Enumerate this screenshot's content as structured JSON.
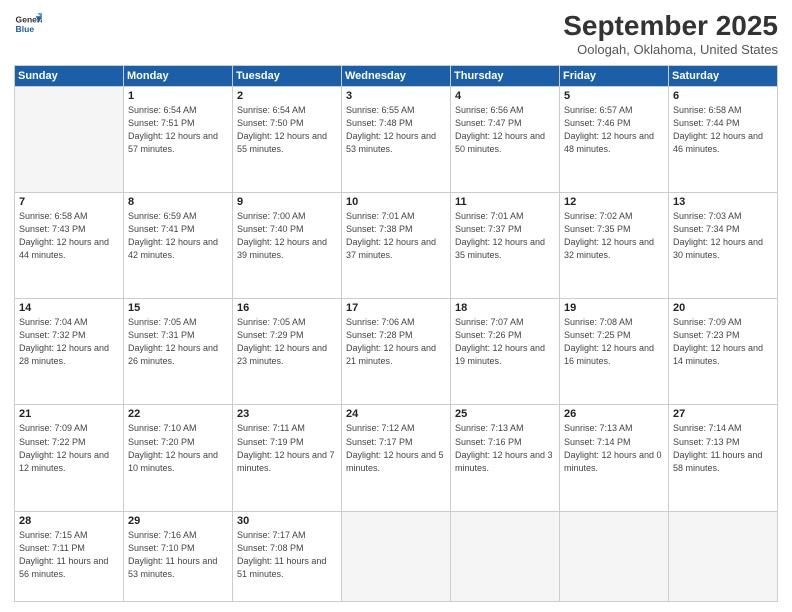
{
  "header": {
    "logo_line1": "General",
    "logo_line2": "Blue",
    "month_title": "September 2025",
    "location": "Oologah, Oklahoma, United States"
  },
  "weekdays": [
    "Sunday",
    "Monday",
    "Tuesday",
    "Wednesday",
    "Thursday",
    "Friday",
    "Saturday"
  ],
  "weeks": [
    [
      {
        "day": "",
        "empty": true
      },
      {
        "day": "1",
        "sunrise": "6:54 AM",
        "sunset": "7:51 PM",
        "daylight": "12 hours and 57 minutes."
      },
      {
        "day": "2",
        "sunrise": "6:54 AM",
        "sunset": "7:50 PM",
        "daylight": "12 hours and 55 minutes."
      },
      {
        "day": "3",
        "sunrise": "6:55 AM",
        "sunset": "7:48 PM",
        "daylight": "12 hours and 53 minutes."
      },
      {
        "day": "4",
        "sunrise": "6:56 AM",
        "sunset": "7:47 PM",
        "daylight": "12 hours and 50 minutes."
      },
      {
        "day": "5",
        "sunrise": "6:57 AM",
        "sunset": "7:46 PM",
        "daylight": "12 hours and 48 minutes."
      },
      {
        "day": "6",
        "sunrise": "6:58 AM",
        "sunset": "7:44 PM",
        "daylight": "12 hours and 46 minutes."
      }
    ],
    [
      {
        "day": "7",
        "sunrise": "6:58 AM",
        "sunset": "7:43 PM",
        "daylight": "12 hours and 44 minutes."
      },
      {
        "day": "8",
        "sunrise": "6:59 AM",
        "sunset": "7:41 PM",
        "daylight": "12 hours and 42 minutes."
      },
      {
        "day": "9",
        "sunrise": "7:00 AM",
        "sunset": "7:40 PM",
        "daylight": "12 hours and 39 minutes."
      },
      {
        "day": "10",
        "sunrise": "7:01 AM",
        "sunset": "7:38 PM",
        "daylight": "12 hours and 37 minutes."
      },
      {
        "day": "11",
        "sunrise": "7:01 AM",
        "sunset": "7:37 PM",
        "daylight": "12 hours and 35 minutes."
      },
      {
        "day": "12",
        "sunrise": "7:02 AM",
        "sunset": "7:35 PM",
        "daylight": "12 hours and 32 minutes."
      },
      {
        "day": "13",
        "sunrise": "7:03 AM",
        "sunset": "7:34 PM",
        "daylight": "12 hours and 30 minutes."
      }
    ],
    [
      {
        "day": "14",
        "sunrise": "7:04 AM",
        "sunset": "7:32 PM",
        "daylight": "12 hours and 28 minutes."
      },
      {
        "day": "15",
        "sunrise": "7:05 AM",
        "sunset": "7:31 PM",
        "daylight": "12 hours and 26 minutes."
      },
      {
        "day": "16",
        "sunrise": "7:05 AM",
        "sunset": "7:29 PM",
        "daylight": "12 hours and 23 minutes."
      },
      {
        "day": "17",
        "sunrise": "7:06 AM",
        "sunset": "7:28 PM",
        "daylight": "12 hours and 21 minutes."
      },
      {
        "day": "18",
        "sunrise": "7:07 AM",
        "sunset": "7:26 PM",
        "daylight": "12 hours and 19 minutes."
      },
      {
        "day": "19",
        "sunrise": "7:08 AM",
        "sunset": "7:25 PM",
        "daylight": "12 hours and 16 minutes."
      },
      {
        "day": "20",
        "sunrise": "7:09 AM",
        "sunset": "7:23 PM",
        "daylight": "12 hours and 14 minutes."
      }
    ],
    [
      {
        "day": "21",
        "sunrise": "7:09 AM",
        "sunset": "7:22 PM",
        "daylight": "12 hours and 12 minutes."
      },
      {
        "day": "22",
        "sunrise": "7:10 AM",
        "sunset": "7:20 PM",
        "daylight": "12 hours and 10 minutes."
      },
      {
        "day": "23",
        "sunrise": "7:11 AM",
        "sunset": "7:19 PM",
        "daylight": "12 hours and 7 minutes."
      },
      {
        "day": "24",
        "sunrise": "7:12 AM",
        "sunset": "7:17 PM",
        "daylight": "12 hours and 5 minutes."
      },
      {
        "day": "25",
        "sunrise": "7:13 AM",
        "sunset": "7:16 PM",
        "daylight": "12 hours and 3 minutes."
      },
      {
        "day": "26",
        "sunrise": "7:13 AM",
        "sunset": "7:14 PM",
        "daylight": "12 hours and 0 minutes."
      },
      {
        "day": "27",
        "sunrise": "7:14 AM",
        "sunset": "7:13 PM",
        "daylight": "11 hours and 58 minutes."
      }
    ],
    [
      {
        "day": "28",
        "sunrise": "7:15 AM",
        "sunset": "7:11 PM",
        "daylight": "11 hours and 56 minutes."
      },
      {
        "day": "29",
        "sunrise": "7:16 AM",
        "sunset": "7:10 PM",
        "daylight": "11 hours and 53 minutes."
      },
      {
        "day": "30",
        "sunrise": "7:17 AM",
        "sunset": "7:08 PM",
        "daylight": "11 hours and 51 minutes."
      },
      {
        "day": "",
        "empty": true
      },
      {
        "day": "",
        "empty": true
      },
      {
        "day": "",
        "empty": true
      },
      {
        "day": "",
        "empty": true
      }
    ]
  ]
}
